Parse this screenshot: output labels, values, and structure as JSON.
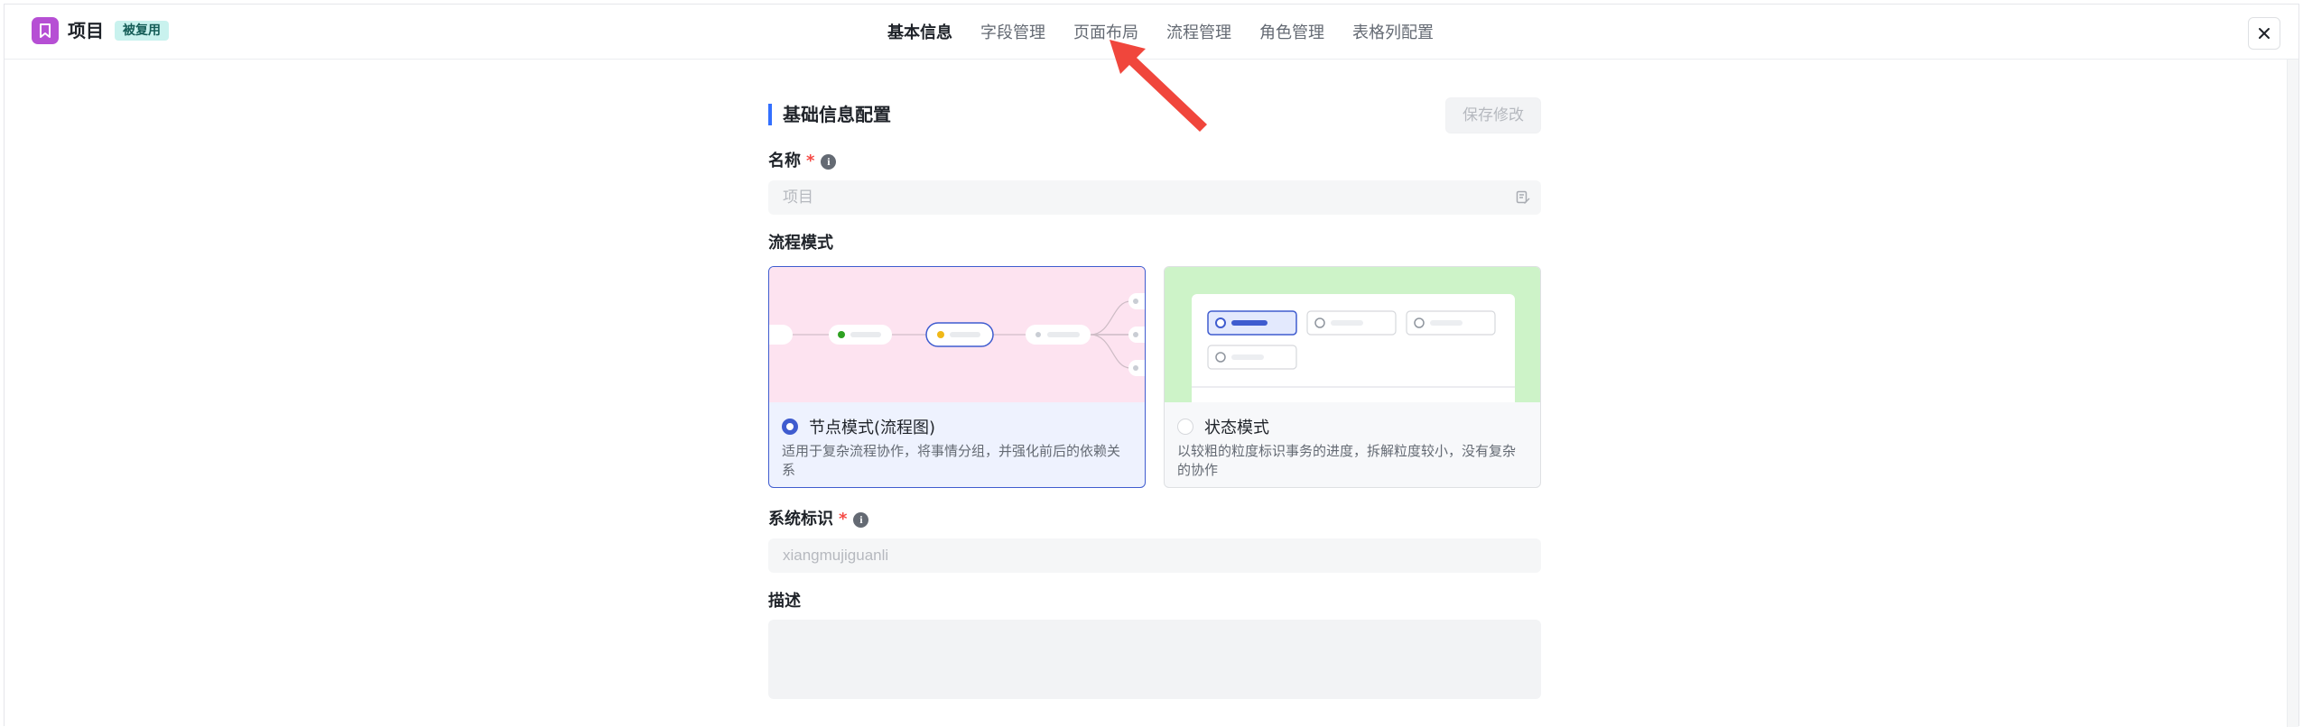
{
  "header": {
    "app_title": "项目",
    "badge": "被复用",
    "tabs": [
      {
        "label": "基本信息",
        "active": true
      },
      {
        "label": "字段管理",
        "active": false
      },
      {
        "label": "页面布局",
        "active": false
      },
      {
        "label": "流程管理",
        "active": false
      },
      {
        "label": "角色管理",
        "active": false
      },
      {
        "label": "表格列配置",
        "active": false
      }
    ],
    "close_icon": "close-icon"
  },
  "form": {
    "section_title": "基础信息配置",
    "save_label": "保存修改",
    "name": {
      "label": "名称",
      "required_mark": "*",
      "placeholder": "项目"
    },
    "flow_mode": {
      "label": "流程模式",
      "options": [
        {
          "title": "节点模式(流程图)",
          "desc": "适用于复杂流程协作，将事情分组，并强化前后的依赖关系",
          "selected": true
        },
        {
          "title": "状态模式",
          "desc": "以较粗的粒度标识事务的进度，拆解粒度较小，没有复杂的协作",
          "selected": false
        }
      ]
    },
    "system_id": {
      "label": "系统标识",
      "required_mark": "*",
      "placeholder": "xiangmujiguanli"
    },
    "description": {
      "label": "描述"
    }
  },
  "colors": {
    "accent": "#3f5ccf",
    "app_icon_bg": "#b64fd4",
    "annotation_arrow": "#f0463c"
  }
}
